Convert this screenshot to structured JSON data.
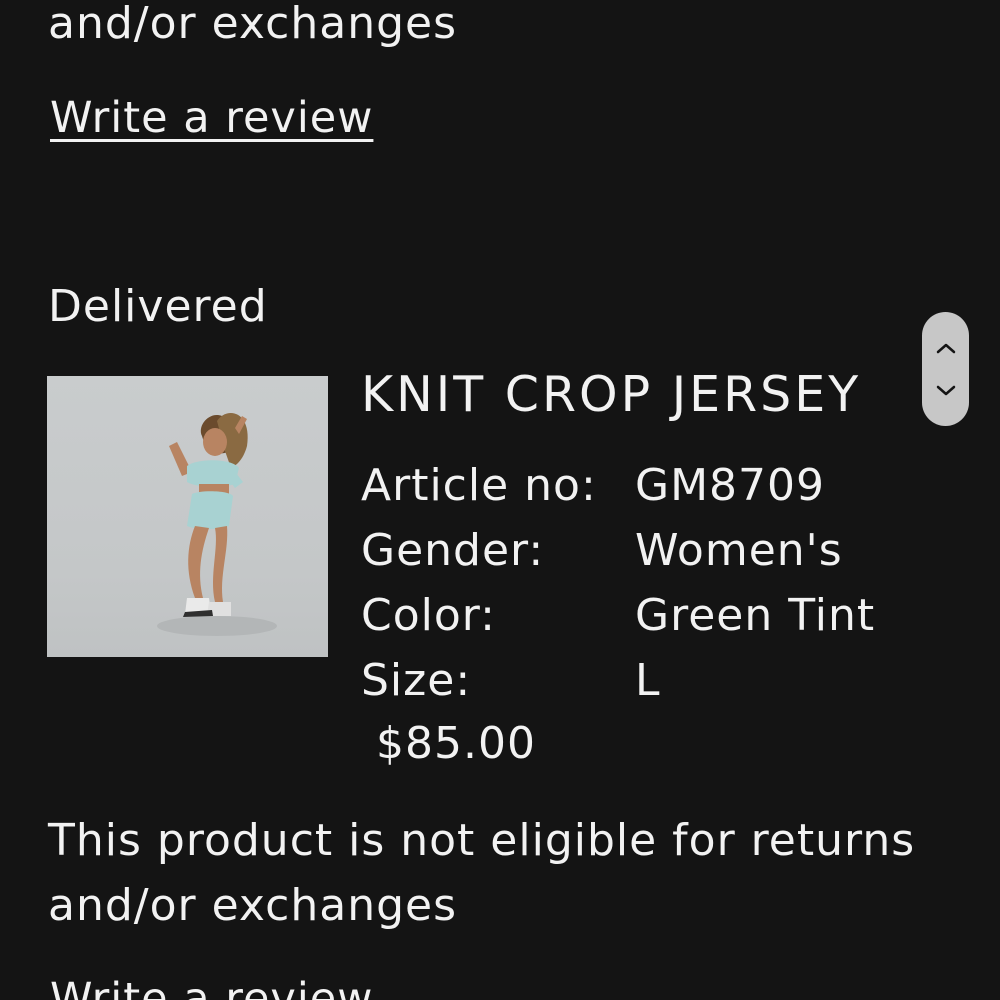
{
  "top_notice": {
    "line2": "and/or exchanges"
  },
  "top_review_link": "Write a review",
  "order_item": {
    "status": "Delivered",
    "image_alt": "Product photo of model wearing knit crop jersey",
    "name": "KNIT CROP JERSEY",
    "attributes": [
      {
        "label": "Article no:",
        "value": "GM8709"
      },
      {
        "label": "Gender:",
        "value": "Women's"
      },
      {
        "label": "Color:",
        "value": "Green Tint"
      },
      {
        "label": "Size:",
        "value": "L"
      }
    ],
    "price": "$85.00",
    "notice_line1": "This product is not eligible for returns",
    "notice_line2": "and/or exchanges",
    "review_link": "Write a review"
  },
  "scroll_control": {
    "up_icon": "chevron-up-icon",
    "down_icon": "chevron-down-icon",
    "color": "#c7c7c7"
  },
  "colors": {
    "background": "#141414",
    "text": "#f2f2f2",
    "image_background": "#c6c9ca"
  }
}
